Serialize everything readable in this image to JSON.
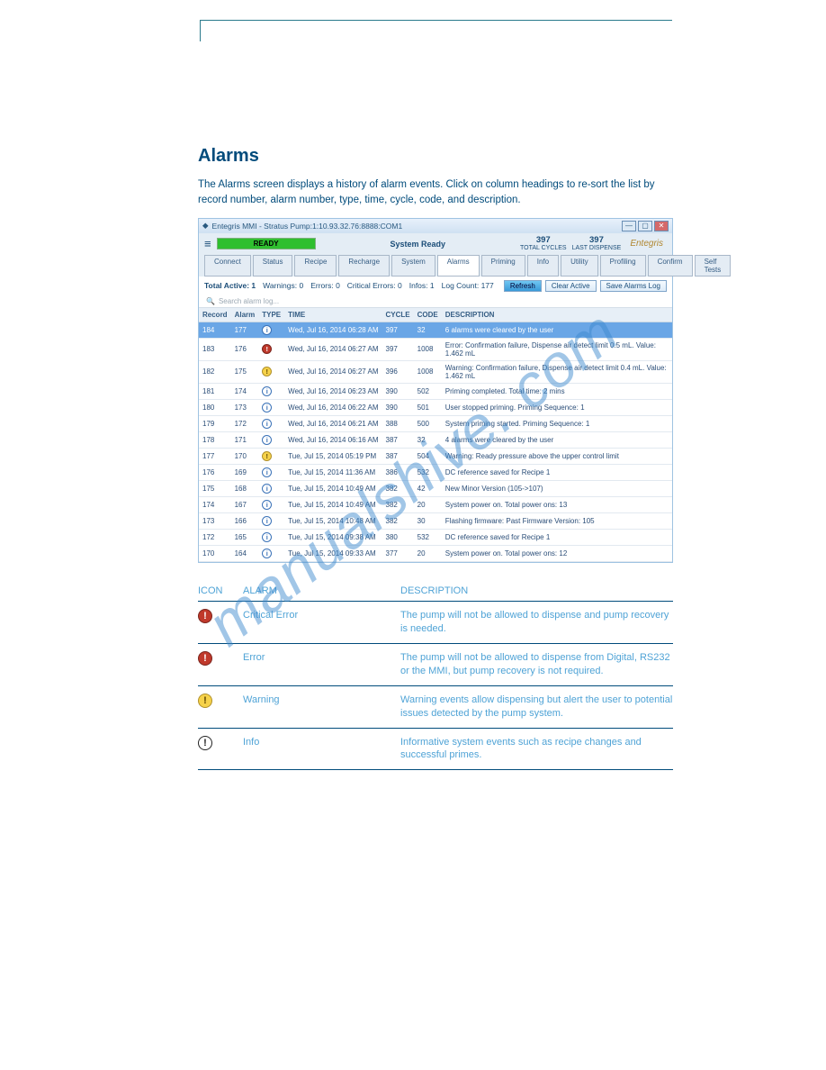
{
  "doc": {
    "section_title": "Alarms",
    "anchor_label": "  ",
    "intro": "The Alarms screen displays a history of alarm events. Click on column headings to re-sort the list by record number, alarm number, type, time, cycle, code, and description.",
    "legend_hdr_icon": "ICON",
    "legend_hdr_alarm": "ALARM",
    "legend_hdr_desc": "DESCRIPTION"
  },
  "watermark": "manualshive. com",
  "legend": [
    {
      "icon": "err",
      "alarm": "Critical Error",
      "desc": "The pump will not be allowed to dispense and pump recovery is needed."
    },
    {
      "icon": "err",
      "alarm": "Error",
      "desc": "The pump will not be allowed to dispense from Digital, RS232 or the MMI, but pump recovery is not required."
    },
    {
      "icon": "warn",
      "alarm": "Warning",
      "desc": "Warning events allow dispensing but alert the user to potential issues detected by the pump system."
    },
    {
      "icon": "plain",
      "alarm": "Info",
      "desc": "Informative system events such as recipe changes and successful primes."
    }
  ],
  "win": {
    "title": "Entegris MMI - Stratus Pump:1:10.93.32.76:8888:COM1",
    "ready": "READY",
    "system_ready": "System Ready",
    "stat1_n": "397",
    "stat1_l": "TOTAL CYCLES",
    "stat2_n": "397",
    "stat2_l": "LAST DISPENSE",
    "logo": "Entegris",
    "tabs": [
      "Connect",
      "Status",
      "Recipe",
      "Recharge",
      "System",
      "Alarms",
      "Priming",
      "Info",
      "Utility",
      "Profiling",
      "Confirm",
      "Self Tests"
    ],
    "summary": {
      "total_active": "Total Active: 1",
      "warnings": "Warnings: 0",
      "errors": "Errors: 0",
      "critical": "Critical Errors: 0",
      "infos": "Infos: 1",
      "logcount": "Log Count: 177"
    },
    "btn_refresh": "Refresh",
    "btn_clear": "Clear Active",
    "btn_save": "Save Alarms Log",
    "search_placeholder": "Search alarm log...",
    "cols": {
      "record": "Record",
      "alarm": "Alarm",
      "type": "TYPE",
      "time": "TIME",
      "cycle": "CYCLE",
      "code": "CODE",
      "desc": "DESCRIPTION"
    },
    "rows": [
      {
        "r": "184",
        "a": "177",
        "t": "info",
        "time": "Wed, Jul 16, 2014 06:28 AM",
        "cy": "397",
        "co": "32",
        "d": "6 alarms were cleared by the user",
        "sel": true
      },
      {
        "r": "183",
        "a": "176",
        "t": "err",
        "time": "Wed, Jul 16, 2014 06:27 AM",
        "cy": "397",
        "co": "1008",
        "d": "Error: Confirmation failure, Dispense air detect limit 0.5 mL. Value: 1.462 mL"
      },
      {
        "r": "182",
        "a": "175",
        "t": "warn",
        "time": "Wed, Jul 16, 2014 06:27 AM",
        "cy": "396",
        "co": "1008",
        "d": "Warning: Confirmation failure, Dispense air detect limit 0.4 mL. Value: 1.462 mL"
      },
      {
        "r": "181",
        "a": "174",
        "t": "info",
        "time": "Wed, Jul 16, 2014 06:23 AM",
        "cy": "390",
        "co": "502",
        "d": "Priming completed. Total time: 2 mins"
      },
      {
        "r": "180",
        "a": "173",
        "t": "info",
        "time": "Wed, Jul 16, 2014 06:22 AM",
        "cy": "390",
        "co": "501",
        "d": "User stopped priming. Priming Sequence: 1"
      },
      {
        "r": "179",
        "a": "172",
        "t": "info",
        "time": "Wed, Jul 16, 2014 06:21 AM",
        "cy": "388",
        "co": "500",
        "d": "System priming started. Priming Sequence: 1"
      },
      {
        "r": "178",
        "a": "171",
        "t": "info",
        "time": "Wed, Jul 16, 2014 06:16 AM",
        "cy": "387",
        "co": "32",
        "d": "4 alarms were cleared by the user"
      },
      {
        "r": "177",
        "a": "170",
        "t": "warn",
        "time": "Tue, Jul 15, 2014 05:19 PM",
        "cy": "387",
        "co": "504",
        "d": "Warning: Ready pressure above the upper control limit"
      },
      {
        "r": "176",
        "a": "169",
        "t": "info",
        "time": "Tue, Jul 15, 2014 11:36 AM",
        "cy": "386",
        "co": "532",
        "d": "DC reference saved for Recipe 1"
      },
      {
        "r": "175",
        "a": "168",
        "t": "info",
        "time": "Tue, Jul 15, 2014 10:49 AM",
        "cy": "382",
        "co": "42",
        "d": "New Minor Version (105->107)"
      },
      {
        "r": "174",
        "a": "167",
        "t": "info",
        "time": "Tue, Jul 15, 2014 10:49 AM",
        "cy": "382",
        "co": "20",
        "d": "System power on. Total power ons: 13"
      },
      {
        "r": "173",
        "a": "166",
        "t": "info",
        "time": "Tue, Jul 15, 2014 10:48 AM",
        "cy": "382",
        "co": "30",
        "d": "Flashing firmware: Past Firmware Version: 105"
      },
      {
        "r": "172",
        "a": "165",
        "t": "info",
        "time": "Tue, Jul 15, 2014 09:38 AM",
        "cy": "380",
        "co": "532",
        "d": "DC reference saved for Recipe 1"
      },
      {
        "r": "170",
        "a": "164",
        "t": "info",
        "time": "Tue, Jul 15, 2014 09:33 AM",
        "cy": "377",
        "co": "20",
        "d": "System power on. Total power ons: 12"
      }
    ]
  }
}
